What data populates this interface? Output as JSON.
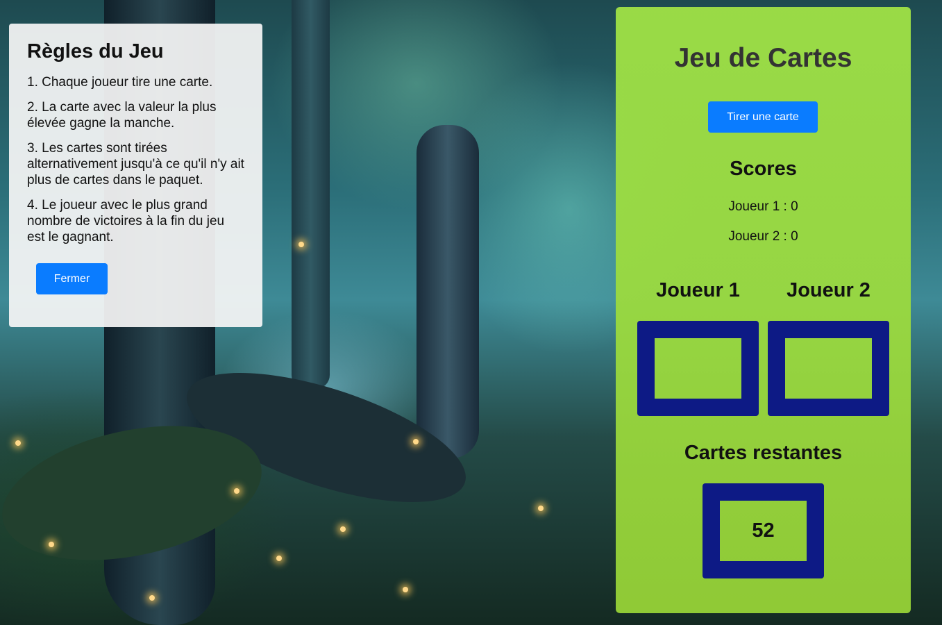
{
  "rules": {
    "title": "Règles du Jeu",
    "items": [
      "1. Chaque joueur tire une carte.",
      "2. La carte avec la valeur la plus élevée gagne la manche.",
      "3. Les cartes sont tirées alternativement jusqu'à ce qu'il n'y ait plus de cartes dans le paquet.",
      "4. Le joueur avec le plus grand nombre de victoires à la fin du jeu est le gagnant."
    ],
    "close_label": "Fermer"
  },
  "game": {
    "title": "Jeu de Cartes",
    "draw_label": "Tirer une carte",
    "scores_title": "Scores",
    "score_lines": [
      "Joueur 1 : 0",
      "Joueur 2 : 0"
    ],
    "players": [
      "Joueur 1",
      "Joueur 2"
    ],
    "remaining_title": "Cartes restantes",
    "remaining_count": "52"
  },
  "colors": {
    "accent_button": "#0a7cff",
    "panel_green": "#a0e246",
    "card_border": "#0d1a85"
  }
}
